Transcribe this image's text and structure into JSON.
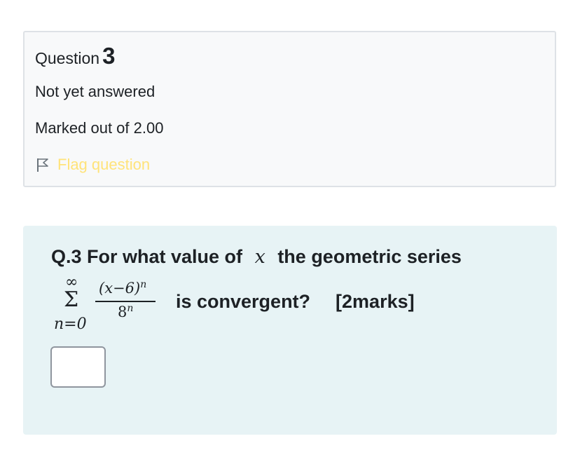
{
  "info": {
    "question_label": "Question",
    "question_number": "3",
    "state": "Not yet answered",
    "grade": "Marked out of 2.00",
    "flag_label": "Flag question"
  },
  "question": {
    "prefix": "Q.3 For what value of",
    "variable": "x",
    "suffix": "the geometric series",
    "series": {
      "sum_upper": "∞",
      "sum_symbol": "Σ",
      "sum_lower": "n=0",
      "numerator_base": "(x−6)",
      "numerator_exp": "n",
      "denominator_base": "8",
      "denominator_exp": "n"
    },
    "continuation": "is convergent?",
    "marks": "[2marks]",
    "answer_value": ""
  },
  "colors": {
    "info_bg": "#f8f9fa",
    "info_border": "#dee2e6",
    "question_bg": "#e7f3f5",
    "flag_text": "#ffe37a",
    "text": "#1d2125"
  },
  "icons": {
    "flag": "flag-outline-icon"
  }
}
